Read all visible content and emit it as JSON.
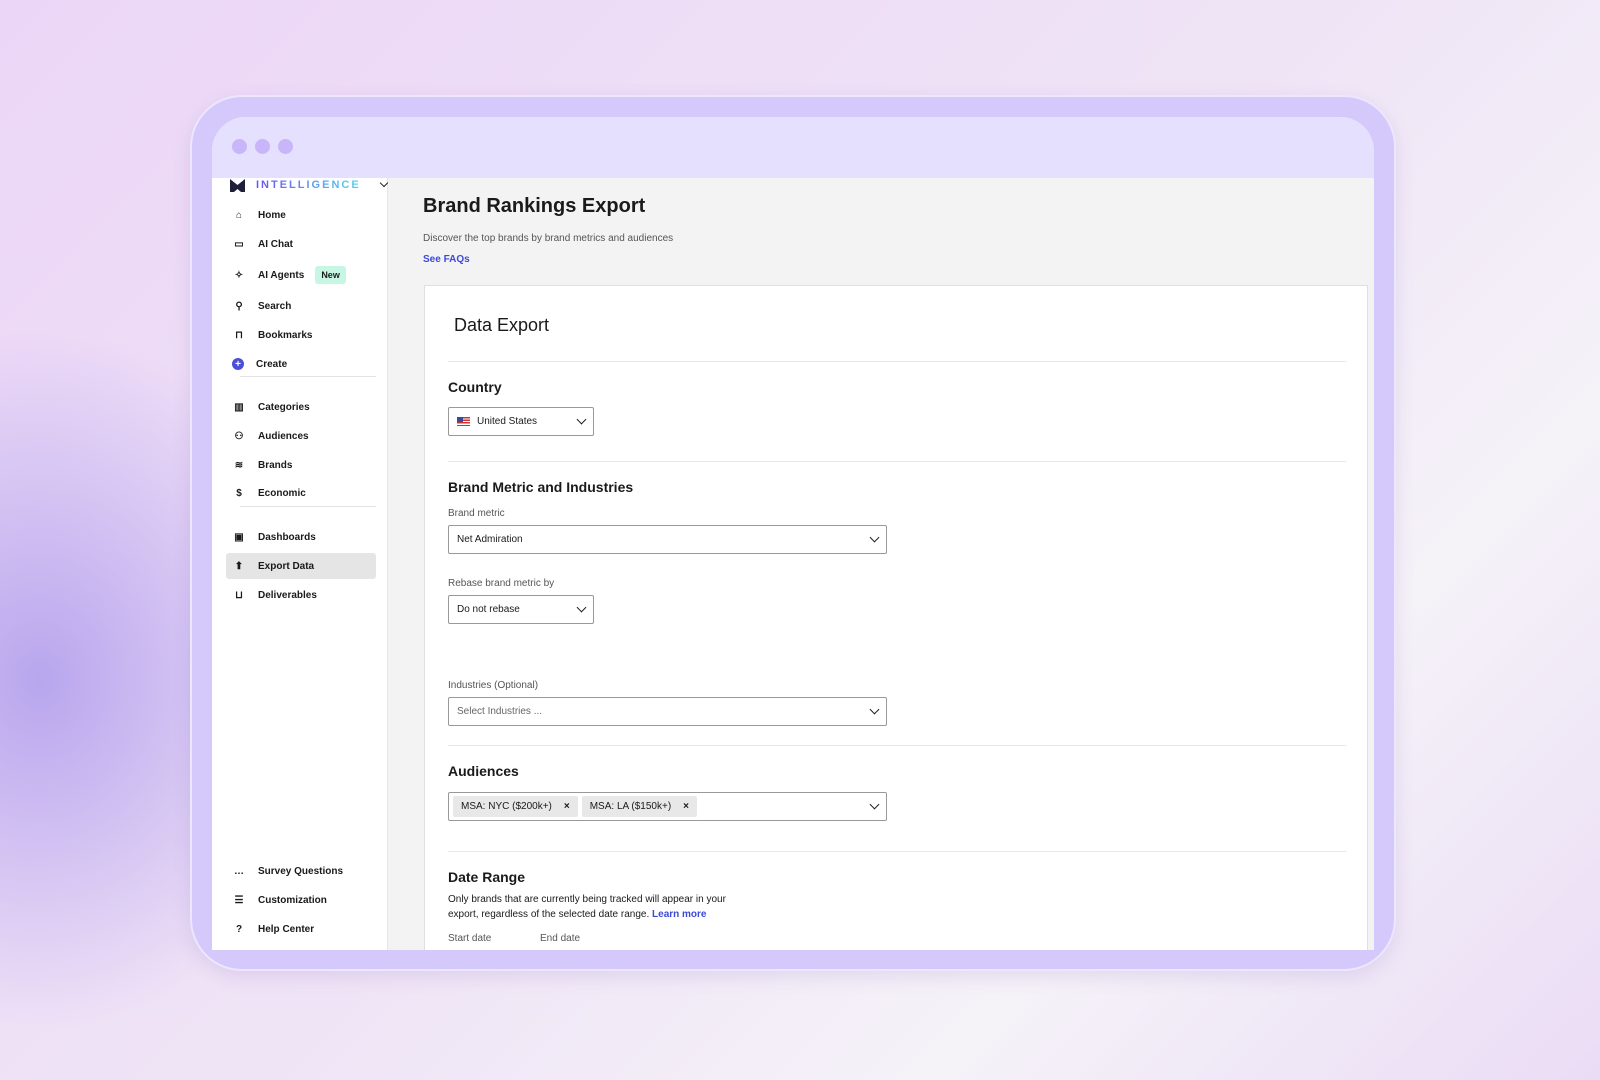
{
  "app": {
    "brand": "INTELLIGENCE"
  },
  "sidebar": {
    "items": [
      {
        "label": "Home",
        "icon": "home-icon"
      },
      {
        "label": "AI Chat",
        "icon": "chat-icon"
      },
      {
        "label": "AI Agents",
        "icon": "sparkle-icon",
        "badge": "New"
      },
      {
        "label": "Search",
        "icon": "search-icon"
      },
      {
        "label": "Bookmarks",
        "icon": "bookmark-icon"
      },
      {
        "label": "Create",
        "icon": "plus-circle-icon"
      },
      {
        "label": "Categories",
        "icon": "chart-icon"
      },
      {
        "label": "Audiences",
        "icon": "users-icon"
      },
      {
        "label": "Brands",
        "icon": "layers-icon"
      },
      {
        "label": "Economic",
        "icon": "dollar-icon"
      },
      {
        "label": "Dashboards",
        "icon": "dashboard-icon"
      },
      {
        "label": "Export Data",
        "icon": "export-icon",
        "active": true
      },
      {
        "label": "Deliverables",
        "icon": "inbox-icon"
      }
    ],
    "bottom": [
      {
        "label": "Survey Questions",
        "icon": "message-icon"
      },
      {
        "label": "Customization",
        "icon": "sliders-icon"
      },
      {
        "label": "Help Center",
        "icon": "help-icon"
      }
    ]
  },
  "page": {
    "title": "Brand Rankings Export",
    "subtitle": "Discover the top brands by brand metrics and audiences",
    "faq": "See FAQs"
  },
  "card": {
    "title": "Data Export",
    "country": {
      "heading": "Country",
      "value": "United States"
    },
    "metric": {
      "heading": "Brand Metric and Industries",
      "metric_label": "Brand metric",
      "metric_value": "Net Admiration",
      "rebase_label": "Rebase brand metric by",
      "rebase_value": "Do not rebase",
      "industries_label": "Industries (Optional)",
      "industries_placeholder": "Select Industries ..."
    },
    "audiences": {
      "heading": "Audiences",
      "chips": [
        "MSA: NYC ($200k+)",
        "MSA: LA ($150k+)"
      ]
    },
    "date": {
      "heading": "Date Range",
      "text": "Only brands that are currently being tracked will appear in your export, regardless of the selected date range.",
      "learn": "Learn more",
      "start_label": "Start date",
      "end_label": "End date"
    }
  },
  "colors": {
    "accent": "#3b49d8",
    "frame": "#d5c9fc",
    "badge": "#c7f6e5"
  }
}
